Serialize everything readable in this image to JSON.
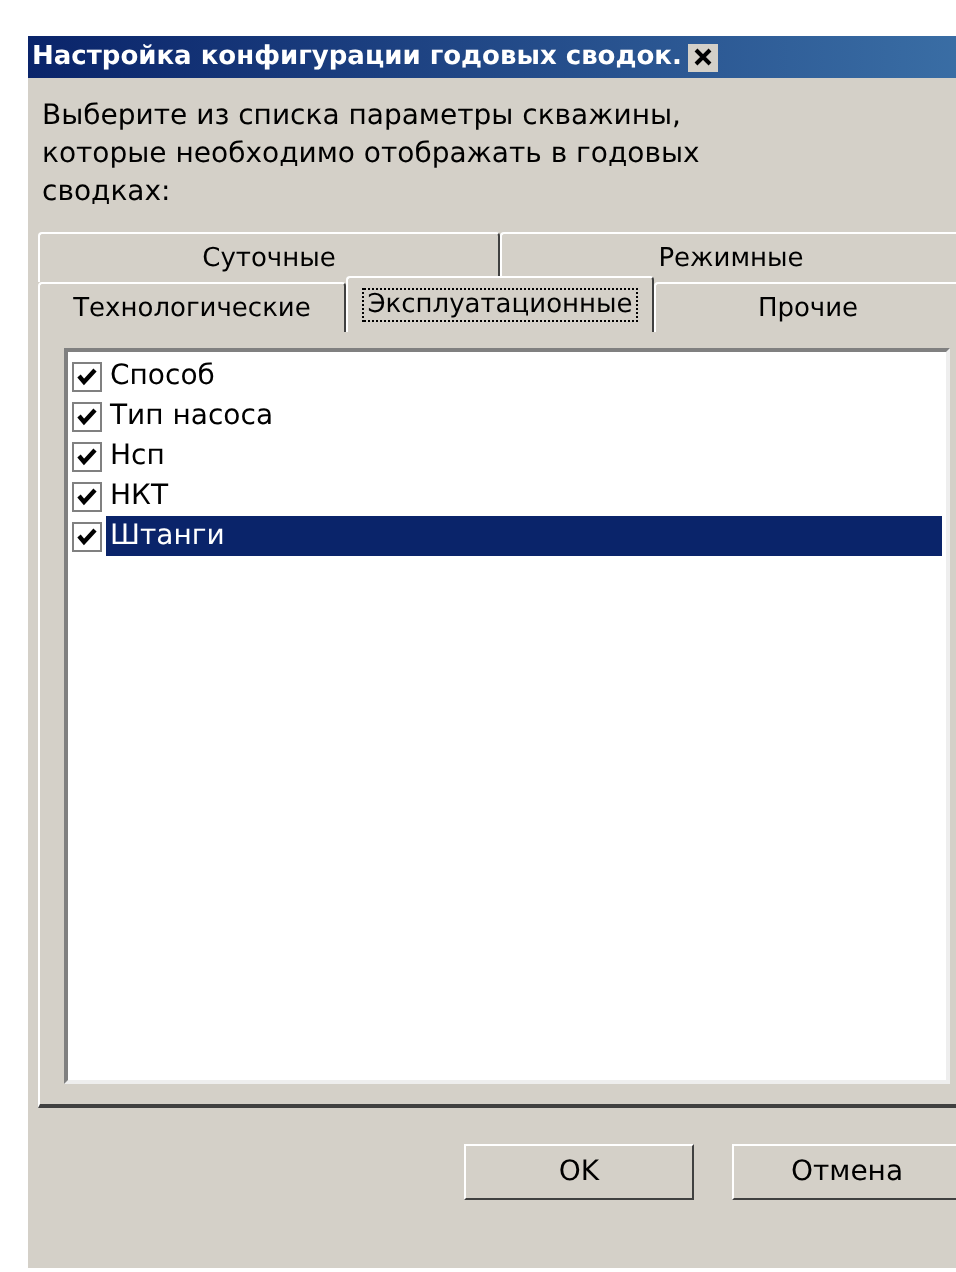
{
  "window": {
    "title": "Настройка конфигурации годовых сводок."
  },
  "instruction": "Выберите из списка параметры скважины, которые необходимо отображать в годовых сводках:",
  "tab_rows": [
    [
      {
        "label": "Суточные",
        "selected": false
      },
      {
        "label": "Режимные",
        "selected": false
      }
    ],
    [
      {
        "label": "Технологические",
        "selected": false
      },
      {
        "label": "Эксплуатационные",
        "selected": true
      },
      {
        "label": "Прочие",
        "selected": false
      }
    ]
  ],
  "items": [
    {
      "label": "Способ",
      "checked": true,
      "selected": false
    },
    {
      "label": "Тип насоса",
      "checked": true,
      "selected": false
    },
    {
      "label": "Нсп",
      "checked": true,
      "selected": false
    },
    {
      "label": "НКТ",
      "checked": true,
      "selected": false
    },
    {
      "label": "Штанги",
      "checked": true,
      "selected": true
    }
  ],
  "buttons": [
    "OK",
    "Отмена"
  ]
}
